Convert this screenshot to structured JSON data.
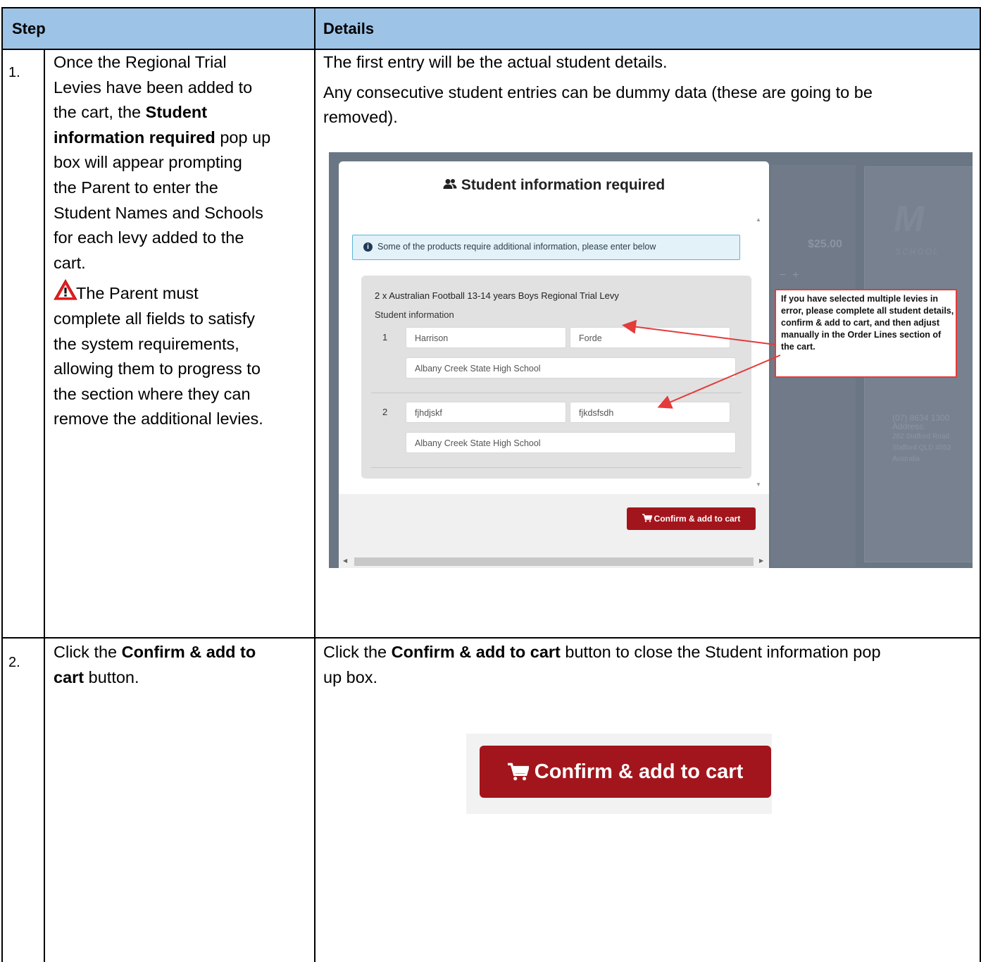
{
  "table": {
    "header": {
      "step": "Step",
      "details": "Details"
    },
    "rows": [
      {
        "number": "1.",
        "step_lines": [
          "Once the Regional Trial",
          "Levies have been added to",
          "the cart, the ",
          "Student",
          "information required",
          " pop up",
          "box will appear prompting",
          "the Parent to enter the",
          "Student Names and Schools",
          "for each levy added to the",
          "cart.",
          "The Parent must",
          "complete all fields to satisfy",
          "the system requirements,",
          "allowing them to progress to",
          "the section where they can",
          "remove the additional levies."
        ],
        "details_line1": "The first entry will be the actual student details.",
        "details_line2a": "Any consecutive student entries can be dummy data (these are going to be",
        "details_line2b": "removed)."
      },
      {
        "number": "2.",
        "step_a": "Click the ",
        "step_b": "Confirm & add to",
        "step_c": "cart",
        "step_d": " button.",
        "details_a": "Click the ",
        "details_b": "Confirm & add to cart",
        "details_c": " button to close the Student information pop",
        "details_d": "up box."
      }
    ]
  },
  "modal": {
    "title": "Student information required",
    "alert": "Some of the products require additional information, please enter below",
    "product": "2 x Australian Football 13-14 years Boys Regional Trial Levy",
    "section_label": "Student information",
    "students": [
      {
        "num": "1",
        "first": "Harrison",
        "last": "Forde",
        "school": "Albany Creek State High School"
      },
      {
        "num": "2",
        "first": "fjhdjskf",
        "last": "fjkdsfsdh",
        "school": "Albany Creek State High School"
      }
    ],
    "confirm_label": "Confirm & add to cart"
  },
  "background": {
    "price": "$25.00",
    "phone": "(07) 8634 1300",
    "address_label": "Address:",
    "address_lines": [
      "282 Stafford Road",
      "Stafford QLD 4053",
      "Australia"
    ]
  },
  "callout": "If you have selected multiple levies in error, please complete all student details, confirm & add to cart, and then adjust manually in the Order Lines section of the cart.",
  "big_button": {
    "label": "Confirm & add to cart"
  },
  "colors": {
    "header": "#9dc3e6",
    "button": "#a3151c",
    "callout_border": "#e43b3b"
  },
  "icons": [
    "warning-icon",
    "people-icon",
    "info-icon",
    "cart-icon"
  ]
}
